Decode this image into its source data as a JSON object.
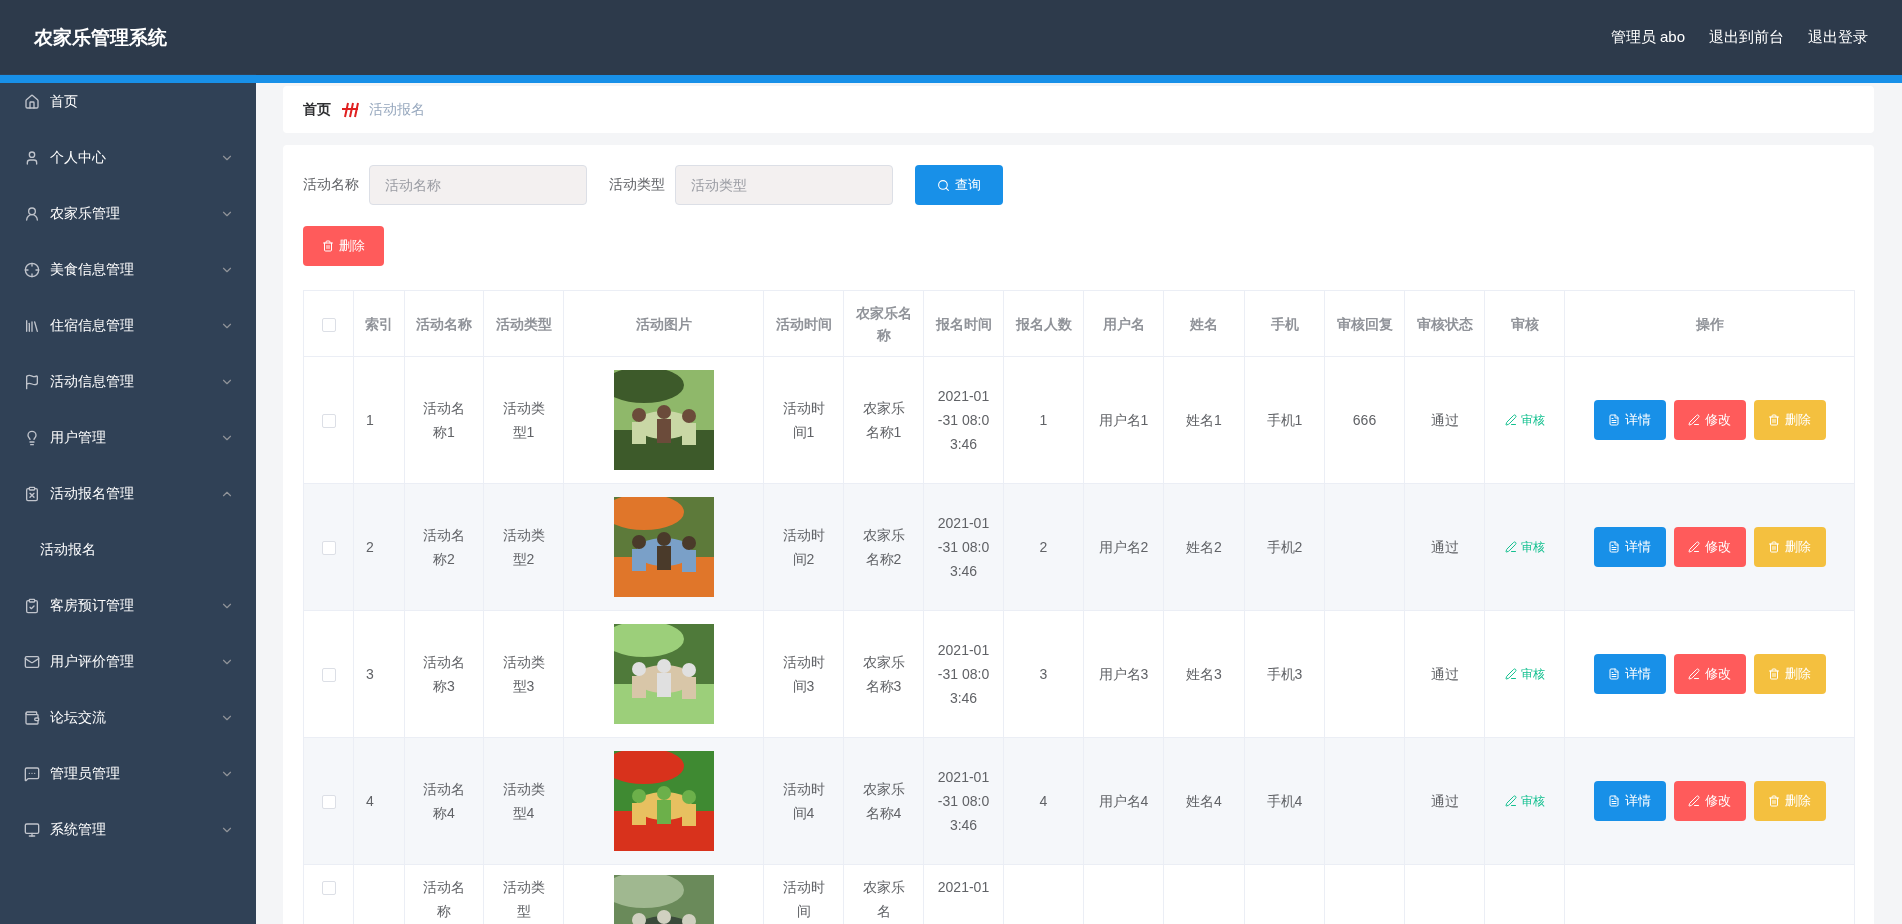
{
  "header": {
    "title": "农家乐管理系统",
    "user": "管理员 abo",
    "links": [
      "退出到前台",
      "退出登录"
    ]
  },
  "sidebar": {
    "items": [
      {
        "label": "首页"
      },
      {
        "label": "个人中心",
        "expanded": false
      },
      {
        "label": "农家乐管理",
        "expanded": false
      },
      {
        "label": "美食信息管理",
        "expanded": false
      },
      {
        "label": "住宿信息管理",
        "expanded": false
      },
      {
        "label": "活动信息管理",
        "expanded": false
      },
      {
        "label": "用户管理",
        "expanded": false
      },
      {
        "label": "活动报名管理",
        "expanded": true,
        "children": [
          {
            "label": "活动报名"
          }
        ]
      },
      {
        "label": "客房预订管理",
        "expanded": false
      },
      {
        "label": "用户评价管理",
        "expanded": false
      },
      {
        "label": "论坛交流",
        "expanded": false
      },
      {
        "label": "管理员管理",
        "expanded": false
      },
      {
        "label": "系统管理",
        "expanded": false
      }
    ]
  },
  "breadcrumb": [
    "首页",
    "活动报名"
  ],
  "search": {
    "fields": [
      {
        "label": "活动名称",
        "placeholder": "活动名称"
      },
      {
        "label": "活动类型",
        "placeholder": "活动类型"
      }
    ],
    "button": "查询"
  },
  "delete_button": "删除",
  "table": {
    "header_checked": false,
    "columns": [
      "索引",
      "活动名称",
      "活动类型",
      "活动图片",
      "活动时间",
      "农家乐名称",
      "报名时间",
      "报名人数",
      "用户名",
      "姓名",
      "手机",
      "审核回复",
      "审核状态",
      "审核",
      "操作"
    ],
    "rows": [
      {
        "checked": false,
        "cut": false,
        "cells": [
          "1",
          "活动名称1",
          "活动类型1",
          {
            "kind": "picture"
          },
          "活动时间1",
          "农家乐名称1",
          "2021-01-31 08:03:46",
          "1",
          "用户名1",
          "姓名1",
          "手机1",
          "666",
          "通过"
        ],
        "audit": "审核",
        "actions": [
          "详情",
          "修改",
          "删除"
        ]
      },
      {
        "checked": false,
        "cut": false,
        "cells": [
          "2",
          "活动名称2",
          "活动类型2",
          {
            "kind": "picture"
          },
          "活动时间2",
          "农家乐名称2",
          "2021-01-31 08:03:46",
          "2",
          "用户名2",
          "姓名2",
          "手机2",
          "",
          "通过"
        ],
        "audit": "审核",
        "actions": [
          "详情",
          "修改",
          "删除"
        ]
      },
      {
        "checked": false,
        "cut": false,
        "cells": [
          "3",
          "活动名称3",
          "活动类型3",
          {
            "kind": "picture"
          },
          "活动时间3",
          "农家乐名称3",
          "2021-01-31 08:03:46",
          "3",
          "用户名3",
          "姓名3",
          "手机3",
          "",
          "通过"
        ],
        "audit": "审核",
        "actions": [
          "详情",
          "修改",
          "删除"
        ]
      },
      {
        "checked": false,
        "cut": false,
        "cells": [
          "4",
          "活动名称4",
          "活动类型4",
          {
            "kind": "picture"
          },
          "活动时间4",
          "农家乐名称4",
          "2021-01-31 08:03:46",
          "4",
          "用户名4",
          "姓名4",
          "手机4",
          "",
          "通过"
        ],
        "audit": "审核",
        "actions": [
          "详情",
          "修改",
          "删除"
        ]
      },
      {
        "checked": false,
        "cut": true,
        "cells": [
          "",
          "活动名称",
          "活动类型",
          {
            "kind": "picture"
          },
          "活动时间",
          "农家乐名",
          "2021-01",
          "",
          "",
          "",
          "",
          "",
          ""
        ]
      }
    ]
  }
}
